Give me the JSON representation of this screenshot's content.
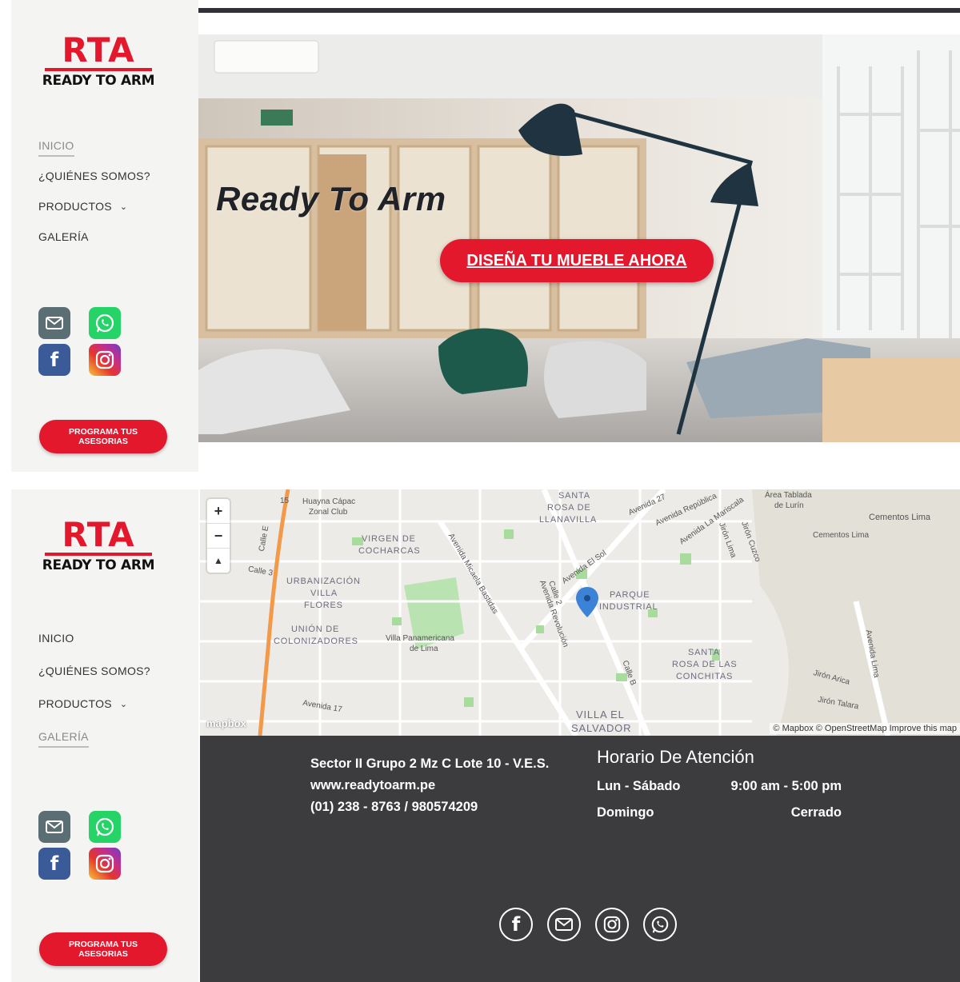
{
  "brand": {
    "logo_main": "RTA",
    "logo_sub": "READY TO ARM"
  },
  "nav": {
    "items": [
      {
        "label": "INICIO"
      },
      {
        "label": "¿QUIÉNES SOMOS?"
      },
      {
        "label": "PRODUCTOS"
      },
      {
        "label": "GALERÍA"
      }
    ]
  },
  "sidebar": {
    "cta_line1": "PROGRAMA TUS",
    "cta_line2": "ASESORIAS"
  },
  "social": [
    "mail-icon",
    "whatsapp-icon",
    "facebook-icon",
    "instagram-icon"
  ],
  "hero": {
    "title": "Ready To Arm",
    "cta": "DISEÑA TU MUEBLE AHORA"
  },
  "map": {
    "labels": {
      "huayna": "Huayna Cápac",
      "zonal": "Zonal Club",
      "santa_rosa_1": "SANTA",
      "santa_rosa_2": "ROSA DE",
      "santa_rosa_3": "LLANAVILLA",
      "virgen_1": "VIRGEN DE",
      "virgen_2": "COCHARCAS",
      "urb_1": "URBANIZACIÓN",
      "urb_2": "VILLA",
      "urb_3": "FLORES",
      "union_1": "UNIÓN DE",
      "union_2": "COLONIZADORES",
      "villa_pan_1": "Villa Panamericana",
      "villa_pan_2": "de Lima",
      "parque_1": "PARQUE",
      "parque_2": "INDUSTRIAL",
      "srconchitas_1": "SANTA",
      "srconchitas_2": "ROSA DE LAS",
      "srconchitas_3": "CONCHITAS",
      "ves_1": "VILLA EL",
      "ves_2": "SALVADOR",
      "cementos_1": "Cementos Lima",
      "cementos_2": "Cementos Lima",
      "tablada_1": "Área Tablada",
      "tablada_2": "de Lurín",
      "av_sol": "Avenida El Sol",
      "av_lima": "Avenida Lima",
      "av_17": "Avenida 17",
      "jr_arica": "Jirón Arica",
      "jr_talara": "Jirón Talara",
      "calle_3": "Calle 3",
      "calle_e": "Calle E",
      "av_micaela": "Avenida Micaela Bastidas",
      "av_revolucion": "Avenida Revolución",
      "av_27": "Avenida 27",
      "av_republica": "Avenida República",
      "av_mariscala": "Avenida La Mariscala",
      "jr_lima": "Jirón Lima",
      "jr_cuzco": "Jirón Cuzco",
      "calle_b": "Calle B",
      "calle_2": "Calle 2",
      "route": "15"
    },
    "zoom_in": "+",
    "zoom_out": "−",
    "compass": "▲",
    "mapbox_logo": "mapbox",
    "attribution": "© Mapbox © OpenStreetMap  Improve this map"
  },
  "footer": {
    "address": "Sector II Grupo 2 Mz C Lote 10 - V.E.S.",
    "website": "www.readytoarm.pe",
    "phone": "(01) 238 - 8763 / 980574209",
    "hours_title": "Horario De Atención",
    "hours": [
      {
        "day": "Lun - Sábado",
        "time": "9:00 am - 5:00 pm"
      },
      {
        "day": "Domingo",
        "time": "Cerrado"
      }
    ]
  }
}
